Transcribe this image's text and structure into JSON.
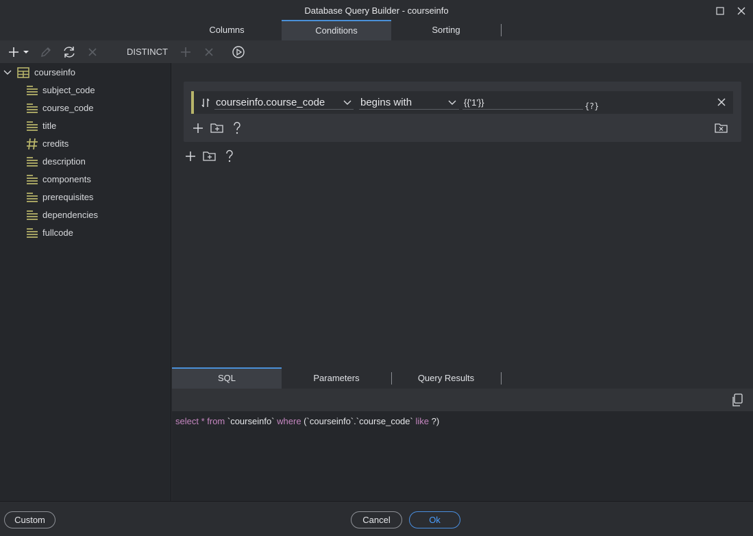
{
  "window": {
    "title": "Database Query Builder - courseinfo"
  },
  "main_tabs": [
    {
      "label": "Columns",
      "active": false
    },
    {
      "label": "Conditions",
      "active": true
    },
    {
      "label": "Sorting",
      "active": false
    }
  ],
  "toolbar": {
    "distinct_label": "DISTINCT"
  },
  "tree": {
    "table": "courseinfo",
    "columns": [
      {
        "name": "subject_code",
        "type": "text"
      },
      {
        "name": "course_code",
        "type": "text"
      },
      {
        "name": "title",
        "type": "text"
      },
      {
        "name": "credits",
        "type": "number"
      },
      {
        "name": "description",
        "type": "text"
      },
      {
        "name": "components",
        "type": "text"
      },
      {
        "name": "prerequisites",
        "type": "text"
      },
      {
        "name": "dependencies",
        "type": "text"
      },
      {
        "name": "fullcode",
        "type": "text"
      }
    ]
  },
  "condition": {
    "field": "courseinfo.course_code",
    "operator": "begins with",
    "value": "{{'1'}}"
  },
  "bottom_tabs": [
    {
      "label": "SQL",
      "active": true
    },
    {
      "label": "Parameters",
      "active": false
    },
    {
      "label": "Query Results",
      "active": false
    }
  ],
  "sql": {
    "kw_select": "select",
    "star": " * ",
    "kw_from": "from",
    "table": " `courseinfo` ",
    "kw_where": "where",
    "cond": " (`courseinfo`.`course_code` ",
    "kw_like": "like",
    "tail": " ?)"
  },
  "footer": {
    "custom_label": "Custom",
    "cancel_label": "Cancel",
    "ok_label": "Ok"
  },
  "colors": {
    "accent": "#4a90d9",
    "icon_olive": "#b8b56a",
    "sql_keyword": "#c586c0"
  }
}
